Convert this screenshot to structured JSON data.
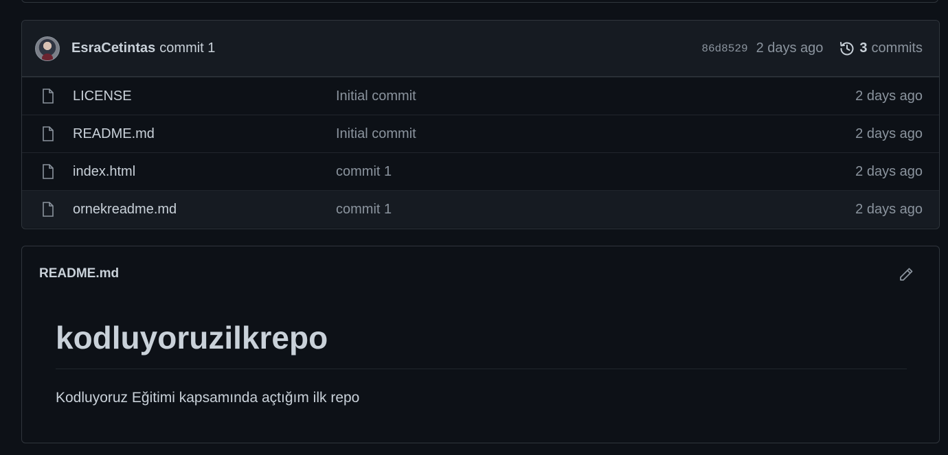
{
  "latest_commit": {
    "author": "EsraCetintas",
    "message": "commit 1",
    "sha": "86d8529",
    "time": "2 days ago",
    "commits_count": "3",
    "commits_label": "commits"
  },
  "files": [
    {
      "name": "LICENSE",
      "commit": "Initial commit",
      "time": "2 days ago",
      "icon": "file-icon"
    },
    {
      "name": "README.md",
      "commit": "Initial commit",
      "time": "2 days ago",
      "icon": "file-icon"
    },
    {
      "name": "index.html",
      "commit": "commit 1",
      "time": "2 days ago",
      "icon": "file-icon"
    },
    {
      "name": "ornekreadme.md",
      "commit": "commit 1",
      "time": "2 days ago",
      "icon": "file-icon"
    }
  ],
  "readme": {
    "filename": "README.md",
    "title": "kodluyoruzilkrepo",
    "text": "Kodluyoruz Eğitimi kapsamında açtığım ilk repo"
  },
  "colors": {
    "background": "#0d1117",
    "border": "#30363d",
    "text": "#c9d1d9",
    "muted": "#8b949e",
    "header_bg": "#161b22"
  }
}
